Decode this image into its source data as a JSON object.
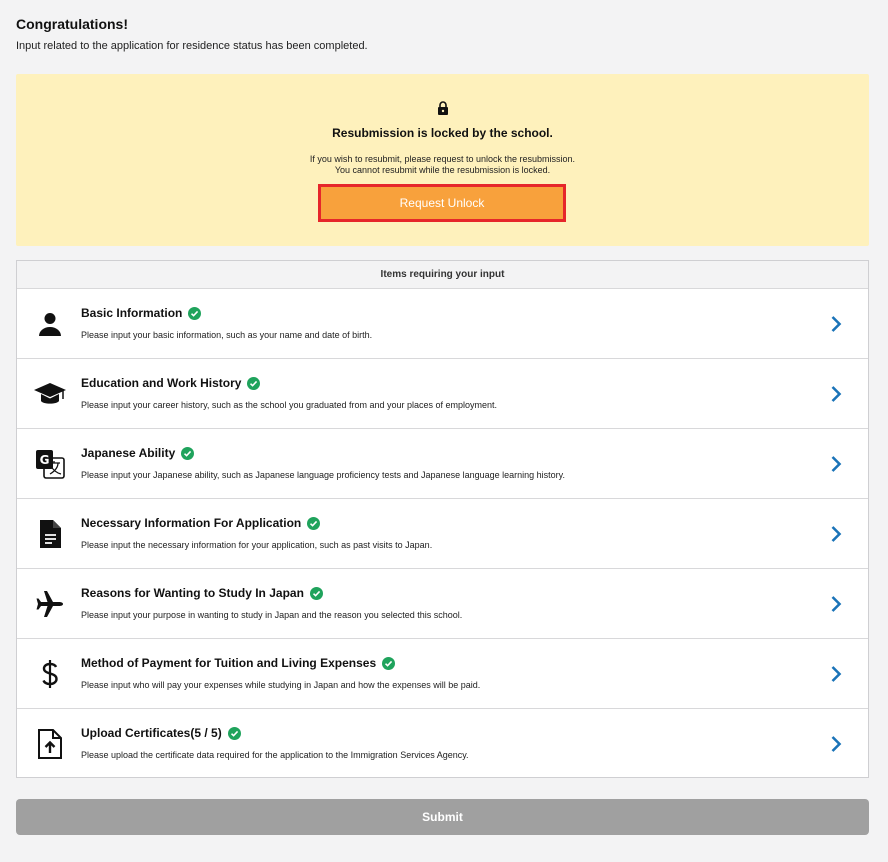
{
  "header": {
    "title": "Congratulations!",
    "subtitle": "Input related to the application for residence status has been completed."
  },
  "lock_notice": {
    "icon": "lock-icon",
    "title": "Resubmission is locked by the school.",
    "description_line1": "If you wish to resubmit, please request to unlock the resubmission.",
    "description_line2": "You cannot resubmit while the resubmission is locked.",
    "button_label": "Request Unlock",
    "background_color": "#fef1bc",
    "button_color": "#f8a13c",
    "highlight_color": "#e6262a"
  },
  "items": {
    "header": "Items requiring your input",
    "list": [
      {
        "icon": "person-icon",
        "title": "Basic Information",
        "description": "Please input your basic information, such as your name and date of birth.",
        "completed": true
      },
      {
        "icon": "graduation-cap-icon",
        "title": "Education and Work History",
        "description": "Please input your career history, such as the school you graduated from and your places of employment.",
        "completed": true
      },
      {
        "icon": "translate-icon",
        "title": "Japanese Ability",
        "description": "Please input your Japanese ability, such as Japanese language proficiency tests and Japanese language learning history.",
        "completed": true
      },
      {
        "icon": "document-icon",
        "title": "Necessary Information For Application",
        "description": "Please input the necessary information for your application, such as past visits to Japan.",
        "completed": true
      },
      {
        "icon": "airplane-icon",
        "title": "Reasons for Wanting to Study In Japan",
        "description": "Please input your purpose in wanting to study in Japan and the reason you selected this school.",
        "completed": true
      },
      {
        "icon": "dollar-icon",
        "title": "Method of Payment for Tuition and Living Expenses",
        "description": "Please input who will pay your expenses while studying in Japan and how the expenses will be paid.",
        "completed": true
      },
      {
        "icon": "file-upload-icon",
        "title": "Upload Certificates(5 / 5)",
        "description": "Please upload the certificate data required for the application to the Immigration Services Agency.",
        "completed": true
      }
    ],
    "check_color": "#1fa35c",
    "chevron_color": "#1a73b8"
  },
  "submit": {
    "label": "Submit",
    "color": "#a0a0a0"
  }
}
